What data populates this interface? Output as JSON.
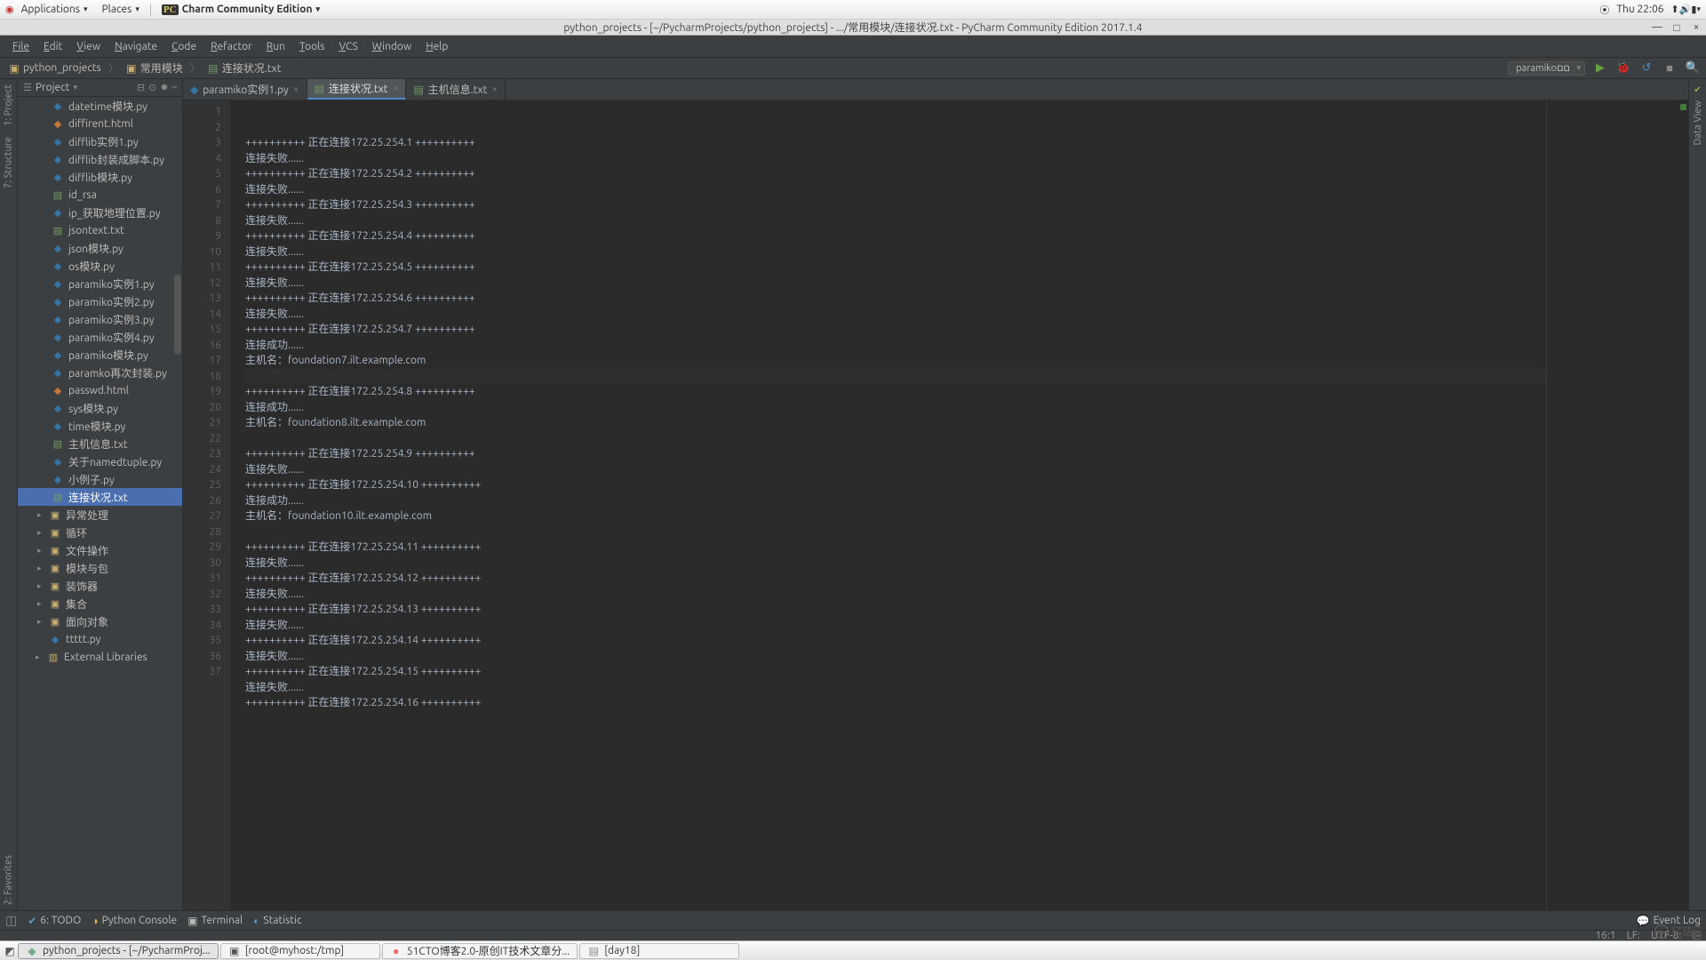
{
  "gnome": {
    "apps": "Applications",
    "places": "Places",
    "app_title": "Charm Community Edition",
    "clock": "Thu 22:06"
  },
  "window": {
    "title": "python_projects - [~/PycharmProjects/python_projects] - .../常用模块/连接状况.txt - PyCharm Community Edition 2017.1.4"
  },
  "menu": [
    "File",
    "Edit",
    "View",
    "Navigate",
    "Code",
    "Refactor",
    "Run",
    "Tools",
    "VCS",
    "Window",
    "Help"
  ],
  "breadcrumb": {
    "root": "python_projects",
    "folder": "常用模块",
    "file": "连接状况.txt"
  },
  "run_config": "paramikoםם",
  "left_tools": [
    "1: Project",
    "7: Structure",
    "2: Favorites"
  ],
  "right_tools": [
    "Data View"
  ],
  "project_header": "Project",
  "tree": {
    "files": [
      {
        "name": "datetime模块.py",
        "t": "py"
      },
      {
        "name": "diffirent.html",
        "t": "html"
      },
      {
        "name": "difflib实例1.py",
        "t": "py"
      },
      {
        "name": "difflib封装成脚本.py",
        "t": "py"
      },
      {
        "name": "difflib模块.py",
        "t": "py"
      },
      {
        "name": "id_rsa",
        "t": "txt"
      },
      {
        "name": "ip_获取地理位置.py",
        "t": "py"
      },
      {
        "name": "jsontext.txt",
        "t": "txt"
      },
      {
        "name": "json模块.py",
        "t": "py"
      },
      {
        "name": "os模块.py",
        "t": "py"
      },
      {
        "name": "paramiko实例1.py",
        "t": "py"
      },
      {
        "name": "paramiko实例2.py",
        "t": "py"
      },
      {
        "name": "paramiko实例3.py",
        "t": "py"
      },
      {
        "name": "paramiko实例4.py",
        "t": "py"
      },
      {
        "name": "paramiko模块.py",
        "t": "py"
      },
      {
        "name": "paramko再次封装.py",
        "t": "py"
      },
      {
        "name": "passwd.html",
        "t": "html"
      },
      {
        "name": "sys模块.py",
        "t": "py"
      },
      {
        "name": "time模块.py",
        "t": "py"
      },
      {
        "name": "主机信息.txt",
        "t": "txt"
      },
      {
        "name": "关于namedtuple.py",
        "t": "py"
      },
      {
        "name": "小例子.py",
        "t": "py"
      },
      {
        "name": "连接状况.txt",
        "t": "txt",
        "selected": true
      }
    ],
    "folders": [
      "异常处理",
      "循环",
      "文件操作",
      "模块与包",
      "装饰器",
      "集合",
      "面向对象"
    ],
    "loose": [
      "ttttt.py"
    ],
    "libs": "External Libraries"
  },
  "tabs": [
    {
      "label": "paramiko实例1.py",
      "t": "py"
    },
    {
      "label": "连接状况.txt",
      "t": "txt",
      "active": true
    },
    {
      "label": "主机信息.txt",
      "t": "txt"
    }
  ],
  "editor": {
    "caret_line": 16,
    "lines": [
      "++++++++++ 正在连接172.25.254.1 ++++++++++",
      "连接失败......",
      "++++++++++ 正在连接172.25.254.2 ++++++++++",
      "连接失败......",
      "++++++++++ 正在连接172.25.254.3 ++++++++++",
      "连接失败......",
      "++++++++++ 正在连接172.25.254.4 ++++++++++",
      "连接失败......",
      "++++++++++ 正在连接172.25.254.5 ++++++++++",
      "连接失败......",
      "++++++++++ 正在连接172.25.254.6 ++++++++++",
      "连接失败......",
      "++++++++++ 正在连接172.25.254.7 ++++++++++",
      "连接成功......",
      "主机名：foundation7.ilt.example.com",
      "",
      "++++++++++ 正在连接172.25.254.8 ++++++++++",
      "连接成功......",
      "主机名：foundation8.ilt.example.com",
      "",
      "++++++++++ 正在连接172.25.254.9 ++++++++++",
      "连接失败......",
      "++++++++++ 正在连接172.25.254.10 ++++++++++",
      "连接成功......",
      "主机名：foundation10.ilt.example.com",
      "",
      "++++++++++ 正在连接172.25.254.11 ++++++++++",
      "连接失败......",
      "++++++++++ 正在连接172.25.254.12 ++++++++++",
      "连接失败......",
      "++++++++++ 正在连接172.25.254.13 ++++++++++",
      "连接失败......",
      "++++++++++ 正在连接172.25.254.14 ++++++++++",
      "连接失败......",
      "++++++++++ 正在连接172.25.254.15 ++++++++++",
      "连接失败......",
      "++++++++++ 正在连接172.25.254.16 ++++++++++"
    ]
  },
  "bottom": {
    "todo": "6: TODO",
    "console": "Python Console",
    "terminal": "Terminal",
    "stat": "Statistic",
    "eventlog": "Event Log"
  },
  "status": {
    "pos": "16:1",
    "lf": "LF:",
    "enc": "UTF-8:",
    "lock": "⎘"
  },
  "taskbar": [
    {
      "icon": "◆",
      "label": "python_projects - [~/PycharmProj...",
      "active": true,
      "color": "#7a8"
    },
    {
      "icon": "▣",
      "label": "[root@myhost:/tmp]",
      "color": "#555"
    },
    {
      "icon": "●",
      "label": "51CTO博客2.0-原创IT技术文章分...",
      "color": "#e66"
    },
    {
      "icon": "▤",
      "label": "[day18]",
      "color": "#888"
    }
  ],
  "watermark": "亿速云"
}
